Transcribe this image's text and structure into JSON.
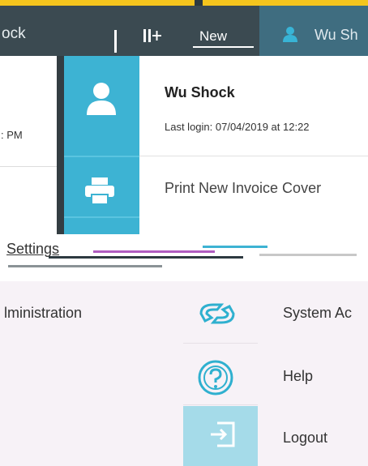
{
  "topbar": {
    "left_fragment": "ock",
    "new_label": "New",
    "user_fragment": "Wu Sh"
  },
  "background": {
    "time_fragment": ": PM",
    "admin_fragment": "lministration"
  },
  "user_menu": {
    "name": "Wu Shock",
    "last_login": "Last login: 07/04/2019 at 12:22",
    "print_label": "Print New Invoice Cover"
  },
  "settings": {
    "label": "Settings"
  },
  "lower_menu": {
    "items": [
      {
        "label": "System Ac",
        "icon": "system-admin-icon"
      },
      {
        "label": "Help",
        "icon": "help-icon"
      },
      {
        "label": "Logout",
        "icon": "logout-icon"
      }
    ]
  },
  "colors": {
    "accent_yellow": "#f5c51d",
    "topbar": "#3b4a51",
    "menu_icon_col": "#3db3d3",
    "logout_tile": "#a5dbe9",
    "icon_cyan": "#2fb0cf"
  }
}
